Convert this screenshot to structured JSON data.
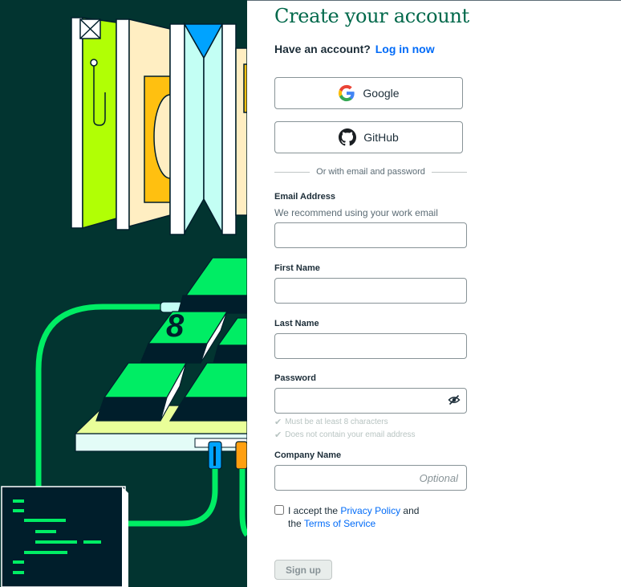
{
  "header": {
    "title": "Create your account",
    "have_account": "Have an account?",
    "login_link": "Log in now"
  },
  "social": {
    "google_label": "Google",
    "github_label": "GitHub"
  },
  "divider_text": "Or with email and password",
  "fields": {
    "email_label": "Email Address",
    "email_hint": "We recommend using your work email",
    "first_name_label": "First Name",
    "last_name_label": "Last Name",
    "password_label": "Password",
    "password_requirements": [
      "Must be at least 8 characters",
      "Does not contain your email address"
    ],
    "company_label": "Company Name",
    "company_placeholder": "Optional"
  },
  "terms": {
    "prefix": "I accept the",
    "privacy_link": "Privacy Policy",
    "middle": "and the",
    "tos_link": "Terms of Service",
    "checked": false
  },
  "signup_label": "Sign up",
  "illustration": {
    "digit": "8"
  },
  "colors": {
    "brand_green": "#00684a",
    "link_blue": "#016bf8",
    "art_background": "#023430",
    "art_accent_green": "#00ed64"
  }
}
